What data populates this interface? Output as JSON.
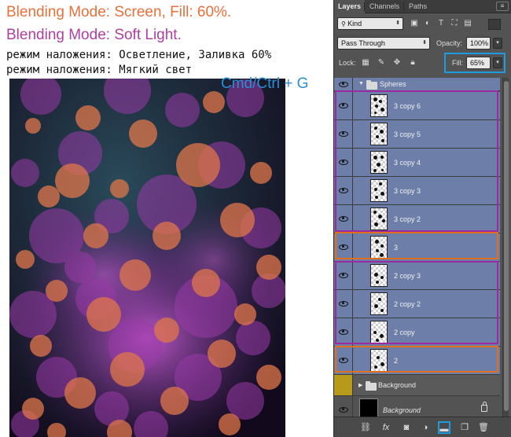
{
  "captions": {
    "line1": "Blending Mode: Screen, Fill: 60%.",
    "line2": "Blending Mode: Soft Light.",
    "line3": "режим наложения: Осветление, Заливка 60%",
    "line4": "режим наложения: Мягкий свет",
    "shortcut": "Cmd/Ctrl + G"
  },
  "colors": {
    "caption_orange": "#e8703a",
    "caption_purple": "#b040a0",
    "shortcut_blue": "#2a8fd6",
    "highlight_blue": "#1e9be0",
    "highlight_purple": "#9a2aa0",
    "highlight_orange": "#e07020",
    "selected_row": "#6d7fa8"
  },
  "panel": {
    "tabs": [
      "Layers",
      "Channels",
      "Paths"
    ],
    "kind_filter": "Kind",
    "blend_mode": "Pass Through",
    "opacity_label": "Opacity:",
    "opacity_value": "100%",
    "lock_label": "Lock:",
    "fill_label": "Fill:",
    "fill_value": "65%"
  },
  "layers": [
    {
      "name": "Spheres",
      "type": "group",
      "expanded": true
    },
    {
      "name": "3 copy 6",
      "type": "layer"
    },
    {
      "name": "3 copy 5",
      "type": "layer"
    },
    {
      "name": "3 copy 4",
      "type": "layer"
    },
    {
      "name": "3 copy 3",
      "type": "layer"
    },
    {
      "name": "3 copy 2",
      "type": "layer"
    },
    {
      "name": "3",
      "type": "layer"
    },
    {
      "name": "2 copy 3",
      "type": "layer"
    },
    {
      "name": "2 copy 2",
      "type": "layer"
    },
    {
      "name": "2 copy",
      "type": "layer"
    },
    {
      "name": "2",
      "type": "layer"
    },
    {
      "name": "Background",
      "type": "group",
      "expanded": false
    },
    {
      "name": "Background",
      "type": "background",
      "locked": true
    }
  ],
  "bottom_icons": [
    "link-icon",
    "fx-icon",
    "add-mask-icon",
    "adjustment-icon",
    "new-group-icon",
    "new-layer-icon",
    "trash-icon"
  ]
}
